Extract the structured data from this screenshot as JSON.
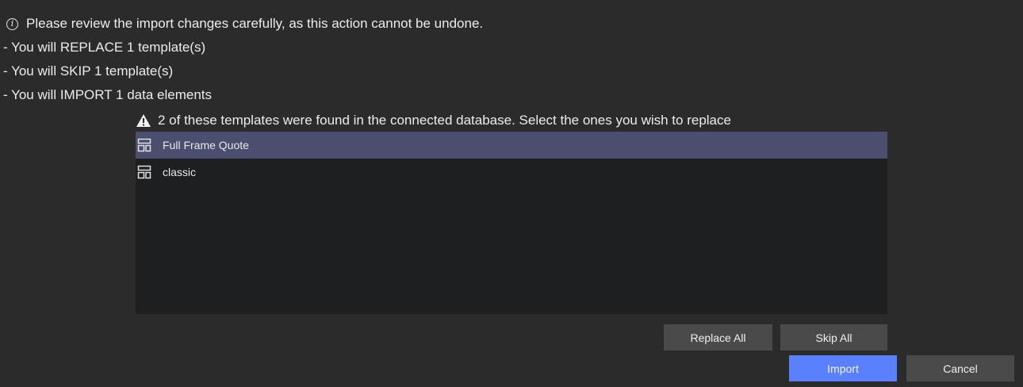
{
  "info": {
    "icon": "info-icon",
    "message": "Please review the import changes carefully, as this action cannot be undone."
  },
  "summary": [
    "- You will REPLACE 1 template(s)",
    "- You will SKIP 1 template(s)",
    "- You will IMPORT 1 data elements"
  ],
  "warning": {
    "icon": "warning-icon",
    "message": "2 of these templates were found in the connected database. Select the ones you wish to replace"
  },
  "templates": [
    {
      "name": "Full Frame Quote",
      "icon": "template-layout-icon",
      "selected": true
    },
    {
      "name": "classic",
      "icon": "template-layout-icon",
      "selected": false
    }
  ],
  "list_actions": {
    "replace_all": "Replace All",
    "skip_all": "Skip All"
  },
  "footer": {
    "import": "Import",
    "cancel": "Cancel"
  },
  "colors": {
    "background": "#2b2b2b",
    "list_background": "#1e1f21",
    "selected_row": "#4a4f70",
    "primary_button": "#5b80ff",
    "secondary_button": "#4a4a4a"
  }
}
